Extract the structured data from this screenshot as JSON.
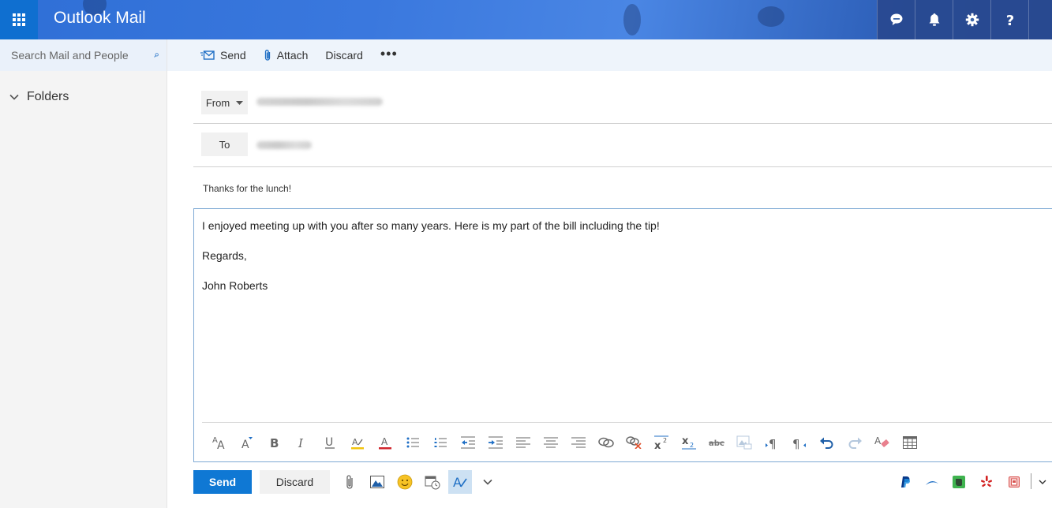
{
  "header": {
    "app_title": "Outlook Mail",
    "icons": [
      "waffle-icon",
      "chat-icon",
      "bell-icon",
      "gear-icon",
      "help-icon"
    ]
  },
  "sidebar": {
    "search_placeholder": "Search Mail and People",
    "folders_label": "Folders"
  },
  "command_bar": {
    "send_label": "Send",
    "attach_label": "Attach",
    "discard_label": "Discard",
    "more_label": "•••"
  },
  "compose": {
    "from_label": "From",
    "to_label": "To",
    "subject": "Thanks for the lunch!",
    "body": [
      "I enjoyed meeting up with you after so many years. Here is my part of the bill including the tip!",
      "Regards,",
      "John Roberts"
    ]
  },
  "format_toolbar": [
    "font-size-icon",
    "grow-font-icon",
    "bold-icon",
    "italic-icon",
    "underline-icon",
    "highlight-icon",
    "font-color-icon",
    "bullets-icon",
    "numbering-icon",
    "decrease-indent-icon",
    "increase-indent-icon",
    "align-left-icon",
    "align-center-icon",
    "align-right-icon",
    "insert-link-icon",
    "remove-link-icon",
    "superscript-icon",
    "subscript-icon",
    "strikethrough-icon",
    "insert-picture-icon",
    "ltr-icon",
    "rtl-icon",
    "undo-icon",
    "redo-icon",
    "clear-format-icon",
    "table-icon"
  ],
  "actions": {
    "send_label": "Send",
    "discard_label": "Discard"
  },
  "colors": {
    "accent": "#0f78d4",
    "header": "#2f6fd6",
    "sidebar": "#f4f4f4",
    "command_bar": "#eef4fb"
  }
}
